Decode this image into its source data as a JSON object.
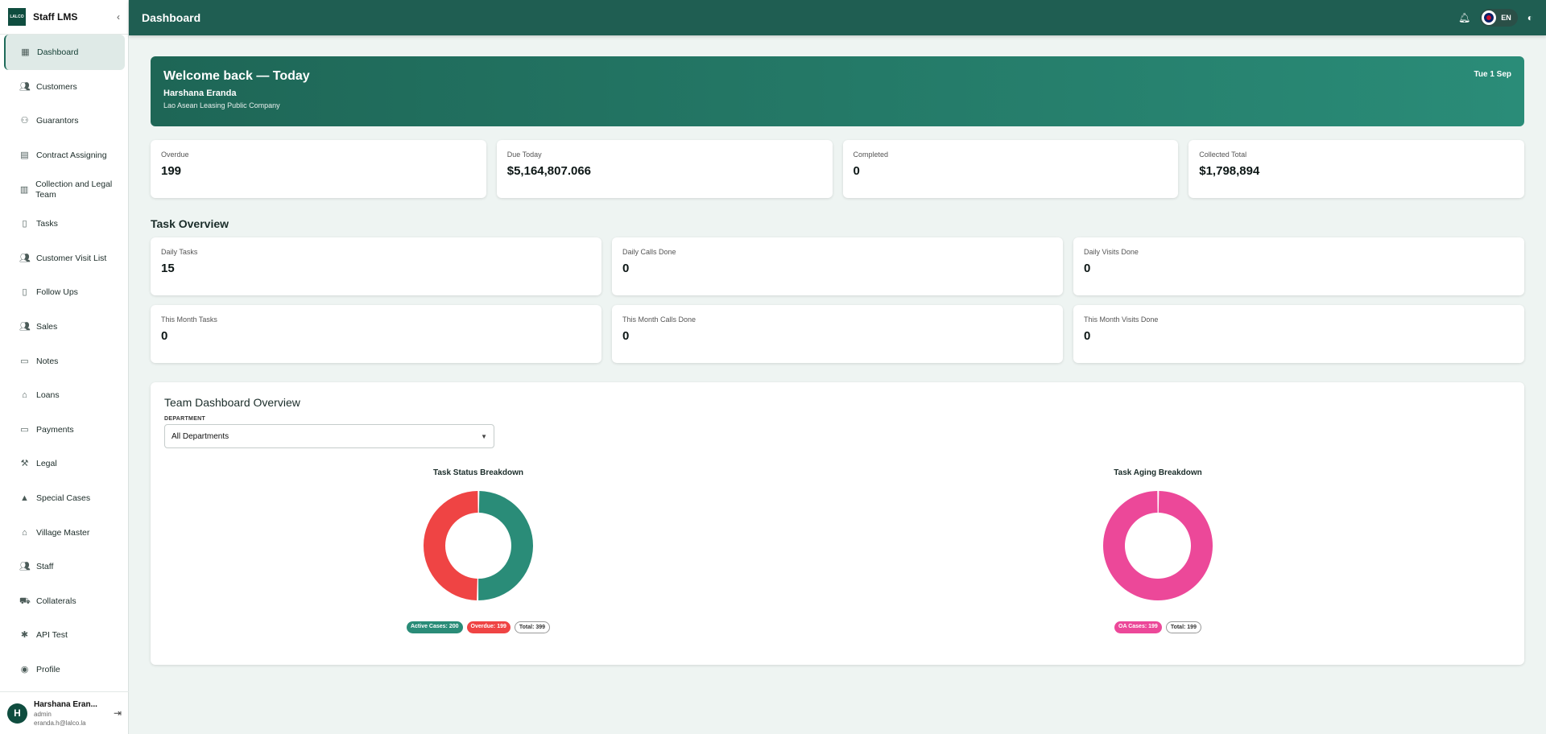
{
  "brand": {
    "logo_text": "LALCO",
    "title": "Staff LMS"
  },
  "nav": [
    {
      "label": "Dashboard",
      "icon": "dashboard-icon",
      "active": true
    },
    {
      "label": "Customers",
      "icon": "people-icon"
    },
    {
      "label": "Guarantors",
      "icon": "group-icon"
    },
    {
      "label": "Contract Assigning",
      "icon": "building-icon"
    },
    {
      "label": "Collection and Legal Team",
      "icon": "table-icon"
    },
    {
      "label": "Tasks",
      "icon": "document-icon"
    },
    {
      "label": "Customer Visit List",
      "icon": "people-icon"
    },
    {
      "label": "Follow Ups",
      "icon": "document-icon"
    },
    {
      "label": "Sales",
      "icon": "people-icon"
    },
    {
      "label": "Notes",
      "icon": "note-icon"
    },
    {
      "label": "Loans",
      "icon": "bank-icon"
    },
    {
      "label": "Payments",
      "icon": "card-icon"
    },
    {
      "label": "Legal",
      "icon": "gavel-icon"
    },
    {
      "label": "Special Cases",
      "icon": "warning-icon"
    },
    {
      "label": "Village Master",
      "icon": "village-icon"
    },
    {
      "label": "Staff",
      "icon": "people-icon"
    },
    {
      "label": "Collaterals",
      "icon": "car-icon"
    },
    {
      "label": "API Test",
      "icon": "bug-icon"
    },
    {
      "label": "Profile",
      "icon": "profile-icon"
    }
  ],
  "user": {
    "initial": "H",
    "name": "Harshana Eran...",
    "role": "admin",
    "email": "eranda.h@lalco.la"
  },
  "topbar": {
    "title": "Dashboard",
    "lang": "EN"
  },
  "welcome": {
    "heading": "Welcome back — Today",
    "name": "Harshana Eranda",
    "company": "Lao Asean Leasing Public Company",
    "date": "Tue 1 Sep"
  },
  "stats": [
    {
      "label": "Overdue",
      "value": "199"
    },
    {
      "label": "Due Today",
      "value": "$5,164,807.066"
    },
    {
      "label": "Completed",
      "value": "0"
    },
    {
      "label": "Collected Total",
      "value": "$1,798,894"
    }
  ],
  "task_overview": {
    "title": "Task Overview",
    "daily": [
      {
        "label": "Daily Tasks",
        "value": "15"
      },
      {
        "label": "Daily Calls Done",
        "value": "0"
      },
      {
        "label": "Daily Visits Done",
        "value": "0"
      }
    ],
    "monthly": [
      {
        "label": "This Month Tasks",
        "value": "0"
      },
      {
        "label": "This Month Calls Done",
        "value": "0"
      },
      {
        "label": "This Month Visits Done",
        "value": "0"
      }
    ]
  },
  "team": {
    "title": "Team Dashboard Overview",
    "dept_label": "DEPARTMENT",
    "dept_value": "All Departments"
  },
  "colors": {
    "teal": "#2a8c78",
    "red": "#ef4444",
    "pink": "#ec4899",
    "brand": "#1f5e52"
  },
  "chart_data": [
    {
      "type": "pie",
      "title": "Task Status Breakdown",
      "categories": [
        "Active Cases",
        "Overdue"
      ],
      "values": [
        200,
        199
      ],
      "colors": [
        "#2a8c78",
        "#ef4444"
      ],
      "legend": [
        "Active Cases: 200",
        "Overdue: 199",
        "Total: 399"
      ]
    },
    {
      "type": "pie",
      "title": "Task Aging Breakdown",
      "categories": [
        "OA Cases"
      ],
      "values": [
        199
      ],
      "colors": [
        "#ec4899"
      ],
      "legend": [
        "OA Cases: 199",
        "Total: 199"
      ]
    }
  ]
}
